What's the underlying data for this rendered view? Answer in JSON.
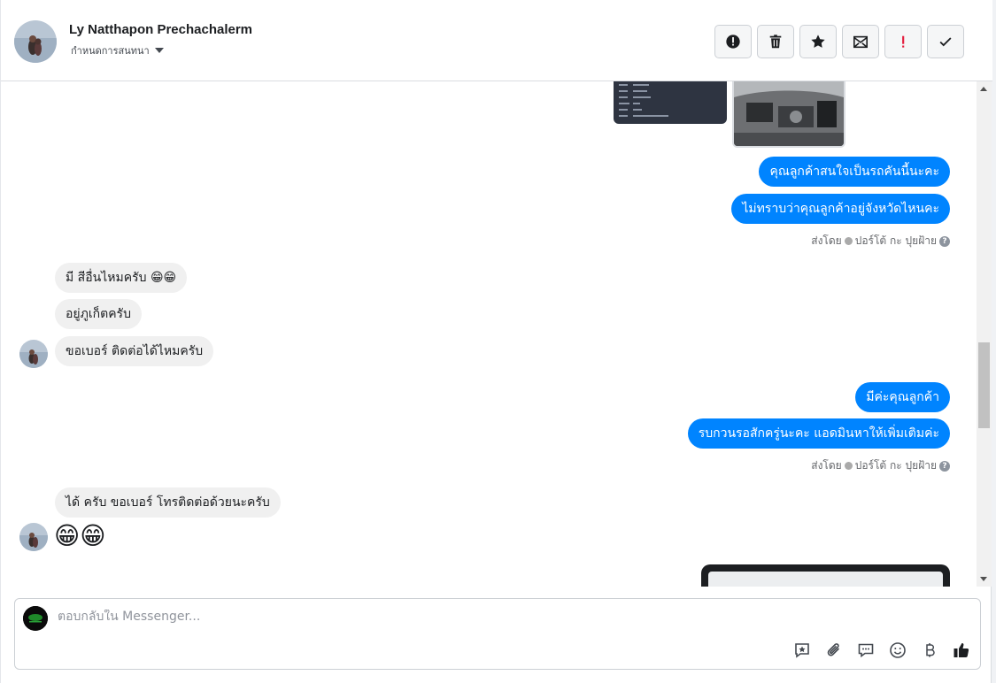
{
  "header": {
    "contact_name": "Ly Natthapon Prechachalerm",
    "assign_label": "กำหนดการสนทนา",
    "actions": [
      {
        "name": "report-spam-button",
        "icon": "alert-icon"
      },
      {
        "name": "delete-button",
        "icon": "trash-icon"
      },
      {
        "name": "star-button",
        "icon": "star-icon"
      },
      {
        "name": "mark-unread-button",
        "icon": "envelope-icon"
      },
      {
        "name": "follow-up-button",
        "icon": "exclamation-icon"
      },
      {
        "name": "mark-done-button",
        "icon": "check-icon"
      }
    ]
  },
  "messages": {
    "out1": "คุณลูกค้าสนใจเป็นรถคันนี้นะคะ",
    "out2": "ไม่ทราบว่าคุณลูกค้าอยู่จังหวัดไหนคะ",
    "sent_by_label": "ส่งโดย",
    "sender": "ปอร์โต้ กะ ปุยฝ้าย",
    "in1": "มี สีอื่นไหมครับ",
    "in1_emoji": "😁😁",
    "in2": "อยู่ภูเก็ตครับ",
    "in3": "ขอเบอร์ ติดต่อได้ไหมครับ",
    "out3": "มีค่ะคุณลูกค้า",
    "out4": "รบกวนรอสักครู่นะคะ แอดมินหาให้เพิ่มเติมค่ะ",
    "in4": "ได้ ครับ ขอเบอร์ โทรติดต่อด้วยนะครับ",
    "in5_emoji": "😁😁"
  },
  "composer": {
    "placeholder": "ตอบกลับใน Messenger...",
    "tools": [
      "saved-reply-icon",
      "attachment-icon",
      "chat-icon",
      "emoji-icon",
      "baht-icon",
      "thumbs-up-icon"
    ]
  },
  "colors": {
    "outgoing_bubble": "#0084ff",
    "incoming_bubble": "#f0f0f0"
  }
}
